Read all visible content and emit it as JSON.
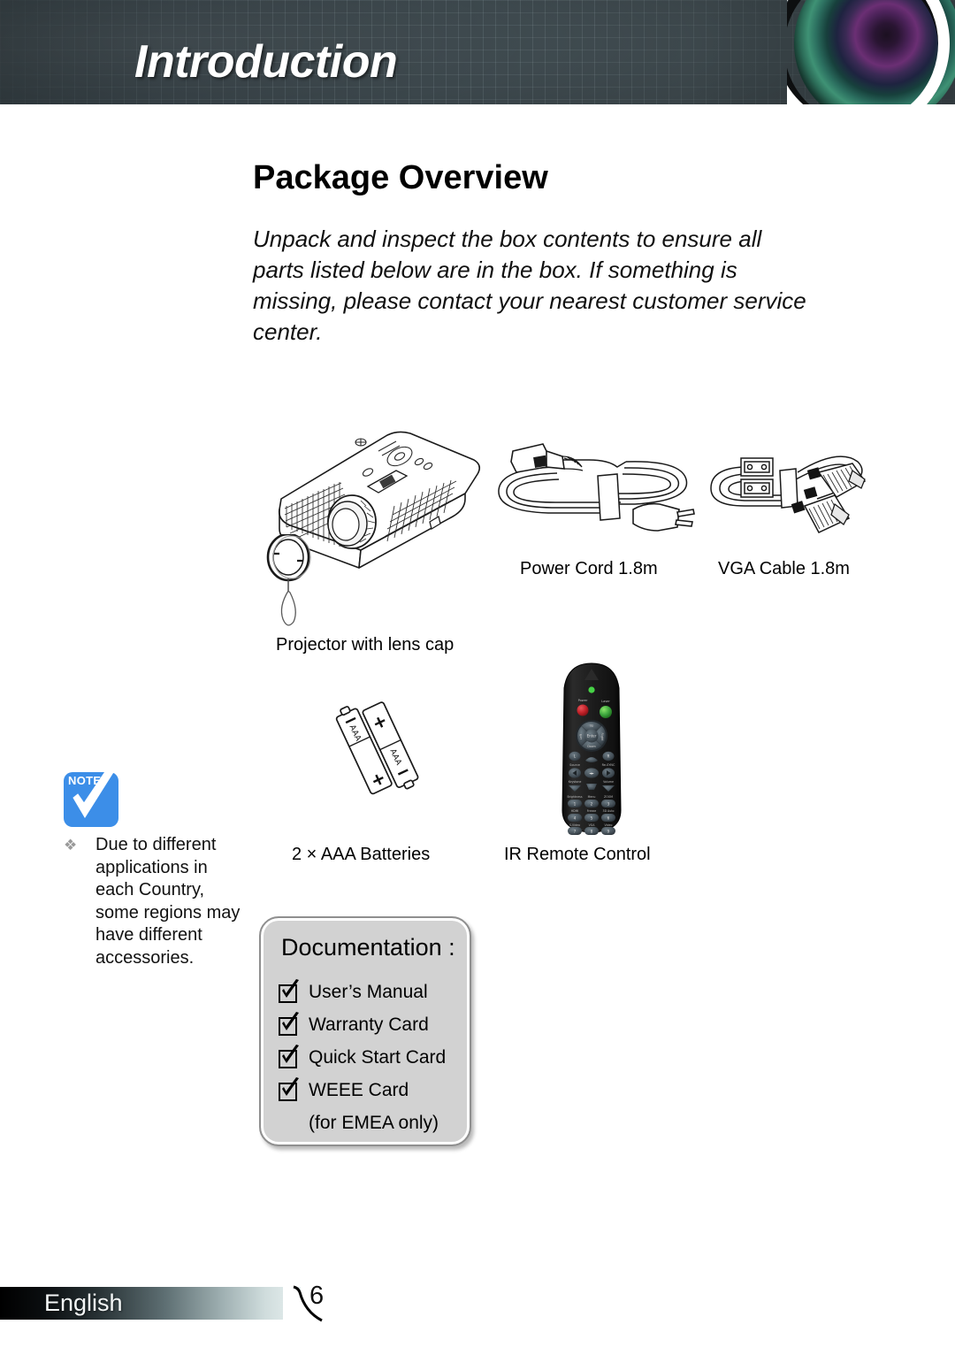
{
  "header": {
    "title": "Introduction",
    "lens_icon": "camera-lens-icon"
  },
  "page": {
    "title": "Package Overview",
    "intro": "Unpack and inspect the box contents to ensure all parts listed below are in the box. If something is missing, please contact your nearest customer service center."
  },
  "items": [
    {
      "name": "projector",
      "label": "Projector with lens cap"
    },
    {
      "name": "power-cord",
      "label": "Power Cord 1.8m"
    },
    {
      "name": "vga-cable",
      "label": "VGA Cable 1.8m"
    },
    {
      "name": "batteries",
      "label": "2 × AAA Batteries"
    },
    {
      "name": "remote",
      "label": "IR Remote Control"
    }
  ],
  "note": {
    "icon_word": "NOTE",
    "bullet": "❖",
    "text": "Due to different applications in each Country, some regions may have different accessories."
  },
  "documentation": {
    "title": "Documentation :",
    "items": [
      "User’s Manual",
      "Warranty Card",
      "Quick Start Card",
      "WEEE Card"
    ],
    "sub_note": "(for EMEA only)"
  },
  "remote_buttons": {
    "power": "Power",
    "laser": "Laser",
    "enter": "Enter",
    "up": "Up",
    "down": "Down",
    "left": "Left",
    "right": "Right",
    "keypad": [
      "1",
      "2",
      "3",
      "4",
      "5",
      "6",
      "7",
      "8",
      "9"
    ]
  },
  "footer": {
    "language": "English",
    "page_number": "6"
  },
  "colors": {
    "header_bg": "#3a4449",
    "note_blue": "#3c8ee8",
    "doc_box_bg": "#d2d2d2",
    "remote_body": "#1a1a1a",
    "power_red": "#c4232a",
    "laser_green": "#3fa83f"
  }
}
